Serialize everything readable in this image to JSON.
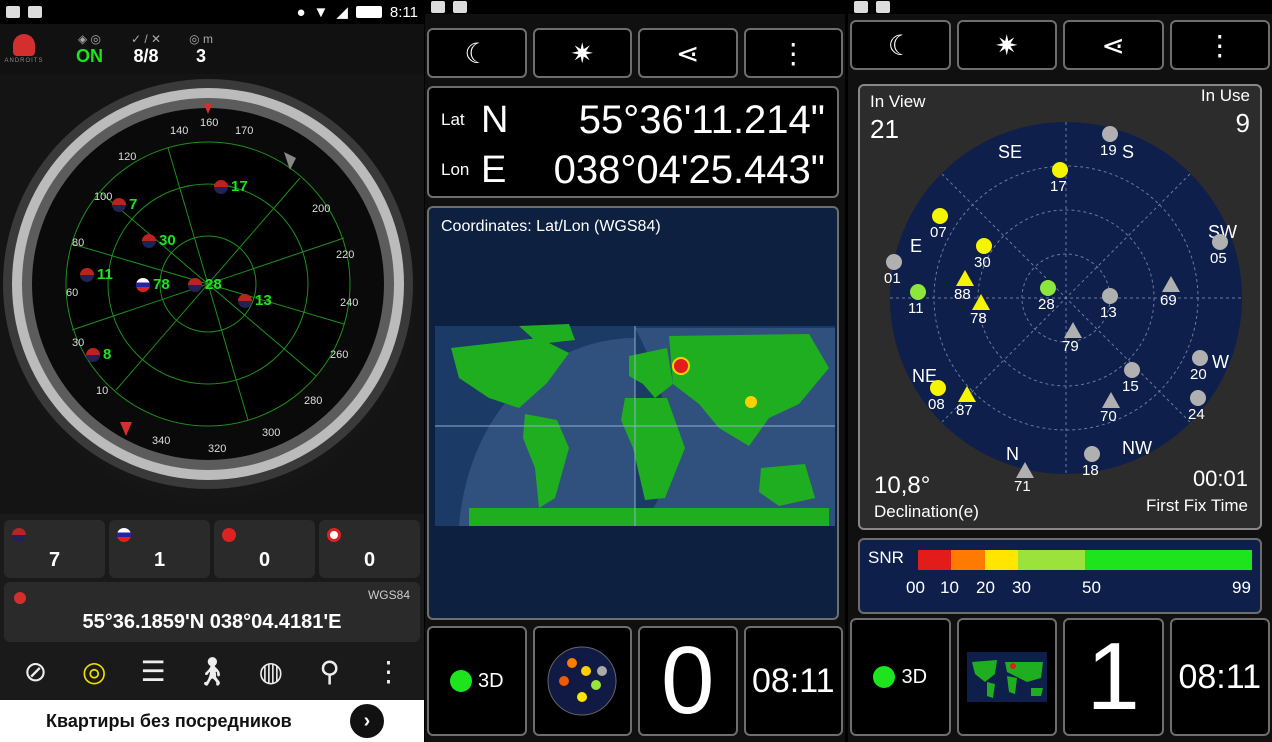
{
  "status": {
    "time1": "8:11",
    "time2": "8:11"
  },
  "p1": {
    "header": {
      "fix_label": "ON",
      "sats_label": "8/8",
      "alt_unit": "m",
      "alt_value": "3"
    },
    "compass_sats": [
      {
        "id": "7",
        "flag": "us"
      },
      {
        "id": "30",
        "flag": "us"
      },
      {
        "id": "17",
        "flag": "us"
      },
      {
        "id": "11",
        "flag": "us"
      },
      {
        "id": "78",
        "flag": "ru"
      },
      {
        "id": "28",
        "flag": "us"
      },
      {
        "id": "13",
        "flag": "us"
      },
      {
        "id": "8",
        "flag": "us"
      }
    ],
    "counts": [
      "7",
      "1",
      "0",
      "0"
    ],
    "datum": "WGS84",
    "coords": "55°36.1859'N  038°04.4181'E",
    "ad_text": "Квартиры без посредников"
  },
  "p2": {
    "lat_label": "Lat",
    "lat_hem": "N",
    "lat_val": "55°36'11.214\"",
    "lon_label": "Lon",
    "lon_hem": "E",
    "lon_val": "038°04'25.443\"",
    "map_caption": "Coordinates: Lat/Lon (WGS84)",
    "fix_type": "3D",
    "count": "0",
    "time": "08:11"
  },
  "p3": {
    "in_view_label": "In View",
    "in_view": "21",
    "in_use_label": "In Use",
    "in_use": "9",
    "declination": "10,8°",
    "declination_label": "Declination(e)",
    "first_fix": "00:01",
    "first_fix_label": "First Fix Time",
    "snr_label": "SNR",
    "snr_ticks": [
      "00",
      "10",
      "20",
      "30",
      "50",
      "99"
    ],
    "fix_type": "3D",
    "count": "1",
    "time": "08:11"
  },
  "colors": {
    "accent_green": "#1de41d",
    "sat_yellow": "#f5f500",
    "sat_green": "#8ce63c",
    "sat_grey": "#b0b0b0"
  },
  "icons": [
    "moon-icon",
    "sun-icon",
    "share-icon",
    "more-vert-icon"
  ]
}
